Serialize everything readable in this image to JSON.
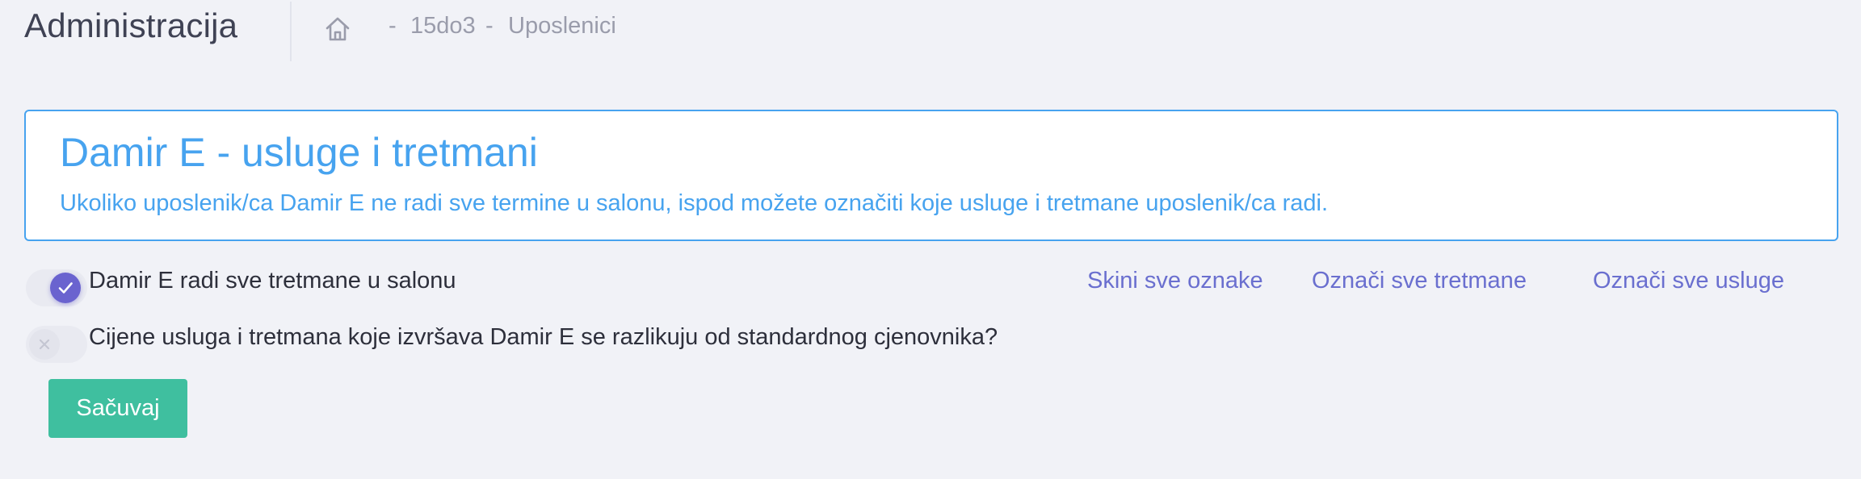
{
  "header": {
    "title": "Administracija",
    "breadcrumb": {
      "home_icon": "home-icon",
      "separator": "-",
      "items": [
        "15do3",
        "Uposlenici"
      ]
    }
  },
  "info_box": {
    "title": "Damir E - usluge i tretmani",
    "description": "Ukoliko uposlenik/ca Damir E ne radi sve termine u salonu, ispod možete označiti koje usluge i tretmane uposlenik/ca radi."
  },
  "options": [
    {
      "label": "Damir E radi sve tretmane u salonu",
      "checked": true,
      "icon": "check-icon"
    },
    {
      "label": "Cijene usluga i tretmana koje izvršava Damir E se razlikuju od standardnog cjenovnika?",
      "checked": false,
      "icon": "close-icon"
    }
  ],
  "actions": {
    "clear_all": "Skini sve oznake",
    "select_all_treatments": "Označi sve tretmane",
    "select_all_services": "Označi sve usluge"
  },
  "save_button": "Sačuvaj",
  "colors": {
    "background": "#f1f2f7",
    "accent_blue": "#47a3ef",
    "toggle_active": "#6a63cf",
    "link": "#6a6fcf",
    "save_button": "#3fbf9f"
  }
}
